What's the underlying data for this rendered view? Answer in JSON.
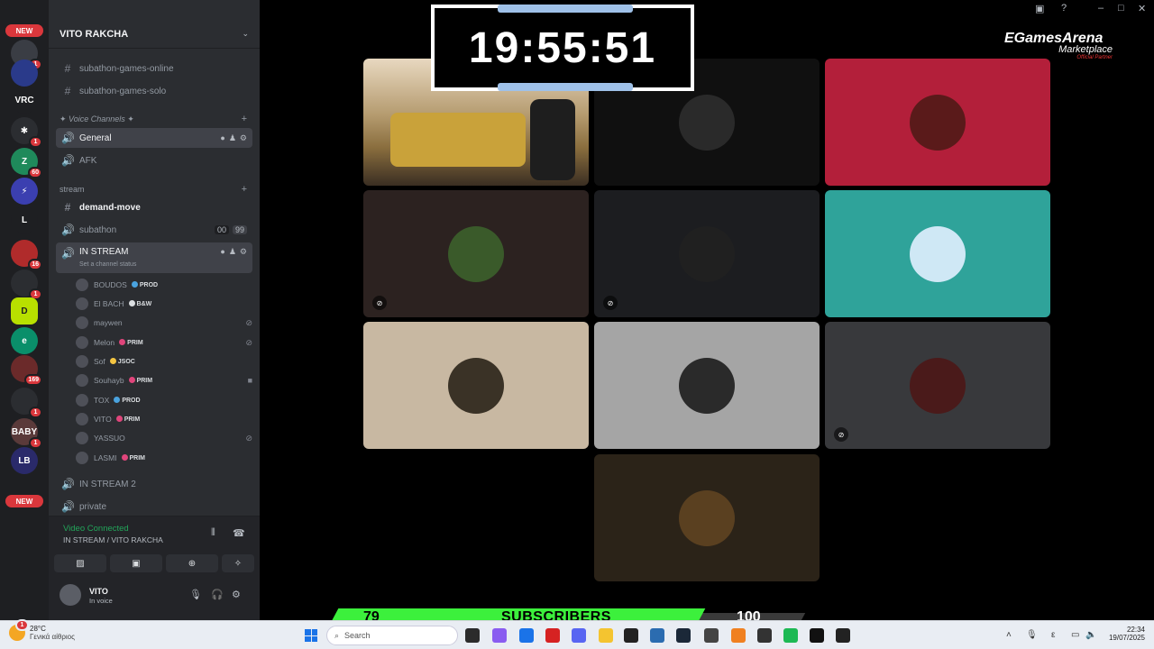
{
  "window": {
    "controls": [
      "inbox-icon",
      "help-icon",
      "minimize",
      "maximize",
      "close"
    ]
  },
  "rail": {
    "new_top": "NEW",
    "new_bottom": "NEW",
    "servers": [
      {
        "label": "",
        "badge": "1",
        "color": "#3a3d44"
      },
      {
        "label": "",
        "badge": "",
        "color": "#2a3a8a"
      },
      {
        "label": "VRC",
        "badge": "",
        "color": "#1e1f22"
      },
      {
        "label": "✱",
        "badge": "1",
        "color": "#2b2d31"
      },
      {
        "label": "Z",
        "badge": "60",
        "color": "#1f8a5b"
      },
      {
        "label": "⚡",
        "badge": "",
        "color": "#3b3fb0"
      },
      {
        "label": "L",
        "badge": "",
        "color": "#1e1f22"
      },
      {
        "label": "",
        "badge": "16",
        "color": "#b02b2b"
      },
      {
        "label": "",
        "badge": "1",
        "color": "#2b2d31"
      },
      {
        "label": "D",
        "badge": "",
        "color": "#b8e000"
      },
      {
        "label": "e",
        "badge": "",
        "color": "#0a8f6a"
      },
      {
        "label": "",
        "badge": "169",
        "color": "#6b2a2a"
      },
      {
        "label": "",
        "badge": "1",
        "color": "#2b2d31"
      },
      {
        "label": "BABY",
        "badge": "1",
        "color": "#5a3a3a"
      },
      {
        "label": "LB",
        "badge": "",
        "color": "#2a2a6a"
      }
    ]
  },
  "sidebar": {
    "server_name": "VITO RAKCHA",
    "channels_top": [
      {
        "name": "subathon-games-online"
      },
      {
        "name": "subathon-games-solo"
      }
    ],
    "voice_category": "✦ Voice Channels ✦",
    "voice_channels": [
      {
        "name": "General"
      },
      {
        "name": "AFK"
      }
    ],
    "stream_category": "stream",
    "stream_channels": [
      {
        "name": "demand-move"
      },
      {
        "name": "subathon",
        "count_a": "00",
        "count_b": "99"
      },
      {
        "name": "IN STREAM",
        "status": "Set a channel status"
      }
    ],
    "members": [
      {
        "name": "BOUDOS",
        "role": "PROD",
        "role_color": "#4aa3df"
      },
      {
        "name": "El BACH",
        "role": "B&W",
        "role_color": "#dbdee1"
      },
      {
        "name": "maywen",
        "role": "",
        "role_color": ""
      },
      {
        "name": "Melon",
        "role": "PRIM",
        "role_color": "#e0457b"
      },
      {
        "name": "Sof",
        "role": "JSOC",
        "role_color": "#f5c542"
      },
      {
        "name": "Souhayb",
        "role": "PRIM",
        "role_color": "#e0457b"
      },
      {
        "name": "TOX",
        "role": "PROD",
        "role_color": "#4aa3df"
      },
      {
        "name": "VITO",
        "role": "PRIM",
        "role_color": "#e0457b"
      },
      {
        "name": "YASSUO",
        "role": "",
        "role_color": ""
      },
      {
        "name": "LASMI",
        "role": "PRIM",
        "role_color": "#e0457b"
      }
    ],
    "channels_bottom": [
      {
        "name": "IN STREAM 2"
      },
      {
        "name": "private"
      }
    ],
    "voice": {
      "status": "Video Connected",
      "location": "IN STREAM / VITO RAKCHA"
    },
    "user": {
      "name": "VITO",
      "status": "In voice"
    }
  },
  "timer": {
    "value": "19:55:51"
  },
  "brand": {
    "name": "EGamesArena",
    "sub": "Marketplace",
    "tag": "Official Partner"
  },
  "tiles": [
    {
      "kind": "video",
      "bg": "#6e5a4a",
      "muted": false
    },
    {
      "kind": "avatar",
      "bg": "#101010",
      "av": "#2a2a2a",
      "muted": false
    },
    {
      "kind": "avatar",
      "bg": "#b31f3a",
      "av": "#5a1a1a",
      "muted": false
    },
    {
      "kind": "avatar",
      "bg": "#2c2220",
      "av": "#3a5a2a",
      "muted": true
    },
    {
      "kind": "avatar",
      "bg": "#1c1d20",
      "av": "#202020",
      "muted": true
    },
    {
      "kind": "avatar",
      "bg": "#2fa39a",
      "av": "#cfe8f5",
      "muted": false
    },
    {
      "kind": "avatar",
      "bg": "#c8b8a2",
      "av": "#3a3226",
      "muted": false
    },
    {
      "kind": "avatar",
      "bg": "#a5a5a5",
      "av": "#2a2a2a",
      "muted": false
    },
    {
      "kind": "avatar",
      "bg": "#38393c",
      "av": "#4a1a1a",
      "muted": true
    },
    {
      "kind": "avatar",
      "bg": "#2b2318",
      "av": "#5a4020",
      "muted": false
    }
  ],
  "subscribers": {
    "current": "79",
    "label": "SUBSCRIBERS",
    "goal": "100",
    "progress": 0.79
  },
  "taskbar": {
    "temp": "28°C",
    "weather_desc": "Γενικά αίθριος",
    "weather_badge": "1",
    "search_placeholder": "Search",
    "lang": "ε",
    "time": "22:34",
    "date": "19/07/2025"
  }
}
